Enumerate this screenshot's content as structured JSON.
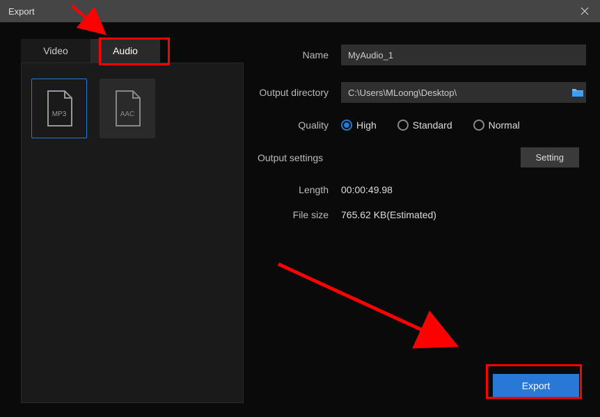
{
  "titlebar": {
    "title": "Export"
  },
  "tabs": {
    "video": "Video",
    "audio": "Audio"
  },
  "formats": {
    "mp3": "MP3",
    "aac": "AAC"
  },
  "form": {
    "name_label": "Name",
    "name_value": "MyAudio_1",
    "output_dir_label": "Output directory",
    "output_dir_value": "C:\\Users\\MLoong\\Desktop\\",
    "quality_label": "Quality",
    "quality_options": {
      "high": "High",
      "standard": "Standard",
      "normal": "Normal"
    },
    "output_settings_label": "Output settings",
    "setting_button": "Setting",
    "length_label": "Length",
    "length_value": "00:00:49.98",
    "filesize_label": "File size",
    "filesize_value": "765.62 KB(Estimated)"
  },
  "export_button": "Export"
}
